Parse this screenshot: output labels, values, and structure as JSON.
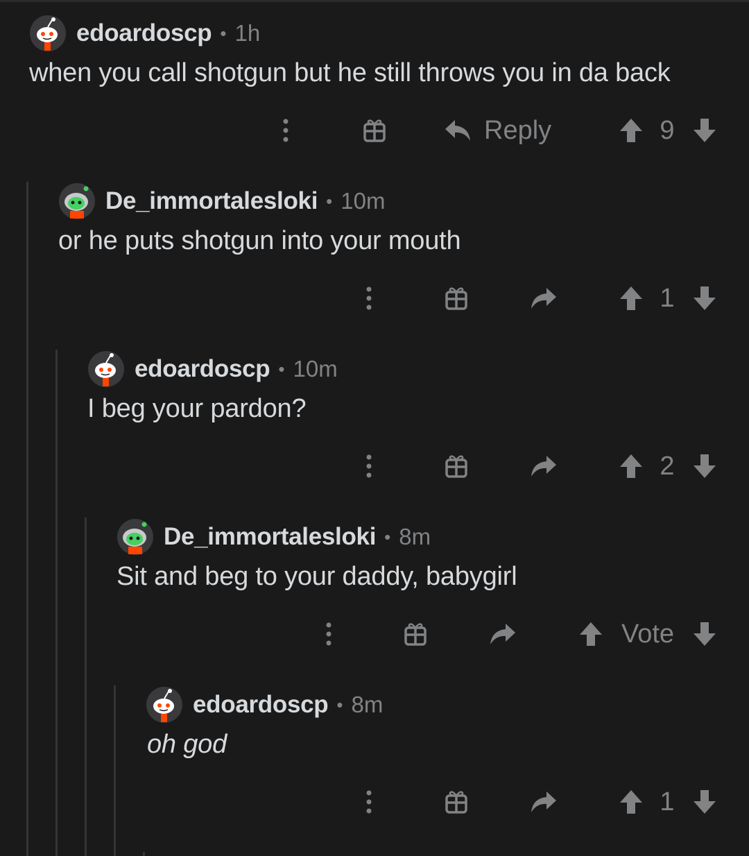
{
  "comments": [
    {
      "author": "edoardoscp",
      "separator": "•",
      "time": "1h",
      "body": "when you call shotgun but he still throws you in da back",
      "reply_label": "Reply",
      "score": "9"
    },
    {
      "author": "De_immortalesloki",
      "separator": "•",
      "time": "10m",
      "body": "or he puts shotgun into your mouth",
      "score": "1"
    },
    {
      "author": "edoardoscp",
      "separator": "•",
      "time": "10m",
      "body": "I beg your pardon?",
      "score": "2"
    },
    {
      "author": "De_immortalesloki",
      "separator": "•",
      "time": "8m",
      "body": "Sit and beg to your daddy, babygirl",
      "score": "Vote"
    },
    {
      "author": "edoardoscp",
      "separator": "•",
      "time": "8m",
      "body": "oh god",
      "score": "1"
    }
  ],
  "icons": {
    "more": "more-options-icon",
    "award": "gift-award-icon",
    "reply": "reply-arrow-icon",
    "upvote": "upvote-arrow-icon",
    "downvote": "downvote-arrow-icon",
    "avatar_default": "snoo-avatar-icon",
    "avatar_green": "snoo-green-avatar-icon"
  },
  "colors": {
    "background": "#1a1a1b",
    "text": "#d7dadc",
    "muted": "#818384",
    "thread_line": "#343536",
    "avatar_green": "#46d160",
    "avatar_red": "#ff4500"
  }
}
